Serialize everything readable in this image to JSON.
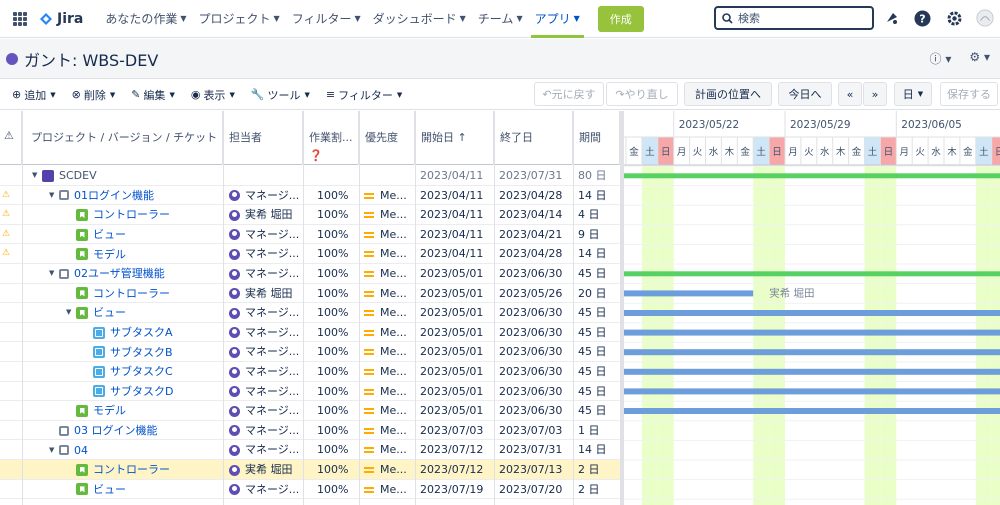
{
  "nav": {
    "product": "Jira",
    "items": [
      {
        "label": "あなたの作業",
        "active": false
      },
      {
        "label": "プロジェクト",
        "active": false
      },
      {
        "label": "フィルター",
        "active": false
      },
      {
        "label": "ダッシュボード",
        "active": false
      },
      {
        "label": "チーム",
        "active": false
      },
      {
        "label": "アプリ",
        "active": true
      }
    ],
    "create_label": "作成",
    "search_placeholder": "検索"
  },
  "page": {
    "title": "ガント: WBS-DEV"
  },
  "toolbar": {
    "add": "追加",
    "delete": "削除",
    "edit": "編集",
    "view": "表示",
    "tools": "ツール",
    "filter": "フィルター",
    "undo": "元に戻す",
    "redo": "やり直し",
    "plan_position": "計画の位置へ",
    "today": "今日へ",
    "prev": "«",
    "next": "»",
    "scale": "日",
    "save": "保存する"
  },
  "columns": {
    "name": "プロジェクト / バージョン / チケット",
    "assignee": "担当者",
    "allocation": "作業割...",
    "priority": "優先度",
    "start": "開始日",
    "end": "終了日",
    "duration": "期間"
  },
  "rows": [
    {
      "name": "SCDEV",
      "type": "project",
      "level": 0,
      "toggle": true,
      "warn": false,
      "assignee": "",
      "alloc": "",
      "prio": "",
      "start": "2023/04/11",
      "end": "2023/07/31",
      "dur": "80 日",
      "gray": true
    },
    {
      "name": "01ログイン機能",
      "type": "version",
      "level": 1,
      "toggle": true,
      "warn": true,
      "assignee": "マネージ...",
      "alloc": "100%",
      "prio": "Me...",
      "start": "2023/04/11",
      "end": "2023/04/28",
      "dur": "14 日"
    },
    {
      "name": "コントローラー",
      "type": "story",
      "level": 2,
      "toggle": false,
      "warn": true,
      "assignee": "実希 堀田",
      "alloc": "100%",
      "prio": "Me...",
      "start": "2023/04/11",
      "end": "2023/04/14",
      "dur": "4 日"
    },
    {
      "name": "ビュー",
      "type": "story",
      "level": 2,
      "toggle": false,
      "warn": true,
      "assignee": "マネージ...",
      "alloc": "100%",
      "prio": "Me...",
      "start": "2023/04/11",
      "end": "2023/04/21",
      "dur": "9 日"
    },
    {
      "name": "モデル",
      "type": "story",
      "level": 2,
      "toggle": false,
      "warn": true,
      "assignee": "マネージ...",
      "alloc": "100%",
      "prio": "Me...",
      "start": "2023/04/11",
      "end": "2023/04/28",
      "dur": "14 日"
    },
    {
      "name": "02ユーザ管理機能",
      "type": "version",
      "level": 1,
      "toggle": true,
      "warn": false,
      "assignee": "マネージ...",
      "alloc": "100%",
      "prio": "Me...",
      "start": "2023/05/01",
      "end": "2023/06/30",
      "dur": "45 日"
    },
    {
      "name": "コントローラー",
      "type": "story",
      "level": 2,
      "toggle": false,
      "warn": false,
      "assignee": "実希 堀田",
      "alloc": "100%",
      "prio": "Me...",
      "start": "2023/05/01",
      "end": "2023/05/26",
      "dur": "20 日"
    },
    {
      "name": "ビュー",
      "type": "story",
      "level": 2,
      "toggle": true,
      "warn": false,
      "assignee": "マネージ...",
      "alloc": "100%",
      "prio": "Me...",
      "start": "2023/05/01",
      "end": "2023/06/30",
      "dur": "45 日"
    },
    {
      "name": "サブタスクA",
      "type": "sub",
      "level": 3,
      "toggle": false,
      "warn": false,
      "assignee": "マネージ...",
      "alloc": "100%",
      "prio": "Me...",
      "start": "2023/05/01",
      "end": "2023/06/30",
      "dur": "45 日"
    },
    {
      "name": "サブタスクB",
      "type": "sub",
      "level": 3,
      "toggle": false,
      "warn": false,
      "assignee": "マネージ...",
      "alloc": "100%",
      "prio": "Me...",
      "start": "2023/05/01",
      "end": "2023/06/30",
      "dur": "45 日"
    },
    {
      "name": "サブタスクC",
      "type": "sub",
      "level": 3,
      "toggle": false,
      "warn": false,
      "assignee": "マネージ...",
      "alloc": "100%",
      "prio": "Me...",
      "start": "2023/05/01",
      "end": "2023/06/30",
      "dur": "45 日"
    },
    {
      "name": "サブタスクD",
      "type": "sub",
      "level": 3,
      "toggle": false,
      "warn": false,
      "assignee": "マネージ...",
      "alloc": "100%",
      "prio": "Me...",
      "start": "2023/05/01",
      "end": "2023/06/30",
      "dur": "45 日"
    },
    {
      "name": "モデル",
      "type": "story",
      "level": 2,
      "toggle": false,
      "warn": false,
      "assignee": "マネージ...",
      "alloc": "100%",
      "prio": "Me...",
      "start": "2023/05/01",
      "end": "2023/06/30",
      "dur": "45 日"
    },
    {
      "name": "03 ログイン機能",
      "type": "version",
      "level": 1,
      "toggle": false,
      "warn": false,
      "assignee": "マネージ...",
      "alloc": "100%",
      "prio": "Me...",
      "start": "2023/07/03",
      "end": "2023/07/03",
      "dur": "1 日"
    },
    {
      "name": "04",
      "type": "version",
      "level": 1,
      "toggle": true,
      "warn": false,
      "assignee": "マネージ...",
      "alloc": "100%",
      "prio": "Me...",
      "start": "2023/07/12",
      "end": "2023/07/31",
      "dur": "14 日"
    },
    {
      "name": "コントローラー",
      "type": "story",
      "level": 2,
      "toggle": false,
      "warn": false,
      "assignee": "実希 堀田",
      "alloc": "100%",
      "prio": "Me...",
      "start": "2023/07/12",
      "end": "2023/07/13",
      "dur": "2 日",
      "highlight": true
    },
    {
      "name": "ビュー",
      "type": "story",
      "level": 2,
      "toggle": false,
      "warn": false,
      "assignee": "マネージ...",
      "alloc": "100%",
      "prio": "Me...",
      "start": "2023/07/19",
      "end": "2023/07/20",
      "dur": "2 日"
    }
  ],
  "gantt": {
    "week_labels": [
      "2023/05/22",
      "2023/05/29",
      "2023/06/05"
    ],
    "days": [
      "金",
      "土",
      "日",
      "月",
      "火",
      "水",
      "木",
      "金",
      "土",
      "日",
      "月",
      "火",
      "水",
      "木",
      "金",
      "土",
      "日",
      "月",
      "火",
      "水",
      "木",
      "金",
      "土",
      "日"
    ],
    "first_day": "2023/05/19",
    "bar_label": "実希 堀田",
    "colors": {
      "version": "#57d163",
      "task": "#6d9edb",
      "weekend": "#eaffc8",
      "sat": "#cfe6f7",
      "sun": "#f6a8a8"
    }
  }
}
